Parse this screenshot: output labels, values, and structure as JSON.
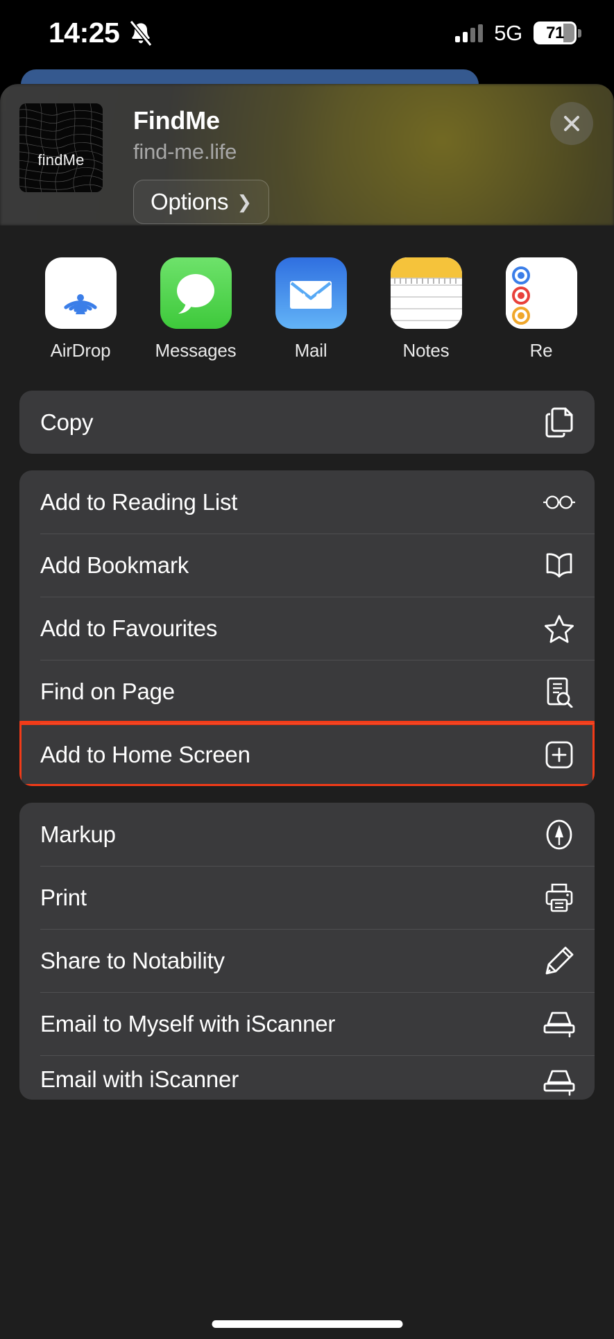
{
  "status_bar": {
    "time": "14:25",
    "silent_icon": "bell-slash-icon",
    "network": "5G",
    "battery_percent": "71",
    "signal_icon": "cellular-signal-icon"
  },
  "share_sheet": {
    "header": {
      "title": "FindMe",
      "subtitle": "find-me.life",
      "thumbnail_label": "findMe",
      "options_label": "Options",
      "options_chevron": "chevron-right-icon",
      "close_icon": "close-icon"
    },
    "apps": [
      {
        "name": "AirDrop",
        "icon": "airdrop-icon"
      },
      {
        "name": "Messages",
        "icon": "messages-icon"
      },
      {
        "name": "Mail",
        "icon": "mail-icon"
      },
      {
        "name": "Notes",
        "icon": "notes-icon"
      },
      {
        "name": "Re",
        "icon": "reminders-icon"
      }
    ],
    "groups": [
      {
        "rows": [
          {
            "label": "Copy",
            "icon": "copy-icon",
            "highlighted": false
          }
        ]
      },
      {
        "rows": [
          {
            "label": "Add to Reading List",
            "icon": "glasses-icon",
            "highlighted": false
          },
          {
            "label": "Add Bookmark",
            "icon": "book-icon",
            "highlighted": false
          },
          {
            "label": "Add to Favourites",
            "icon": "star-icon",
            "highlighted": false
          },
          {
            "label": "Find on Page",
            "icon": "find-page-icon",
            "highlighted": false
          },
          {
            "label": "Add to Home Screen",
            "icon": "plus-square-icon",
            "highlighted": true
          }
        ]
      },
      {
        "rows": [
          {
            "label": "Markup",
            "icon": "markup-icon",
            "highlighted": false
          },
          {
            "label": "Print",
            "icon": "printer-icon",
            "highlighted": false
          },
          {
            "label": "Share to Notability",
            "icon": "pencil-icon",
            "highlighted": false
          },
          {
            "label": "Email to Myself with iScanner",
            "icon": "scanner-icon",
            "highlighted": false
          },
          {
            "label": "Email with iScanner",
            "icon": "scanner-icon",
            "highlighted": false
          }
        ]
      }
    ]
  },
  "colors": {
    "highlight_border": "#f23b18",
    "sheet_background": "#1e1e1e",
    "row_background": "#3a3a3c",
    "tab_blue": "#35598f",
    "messages_green": "#3ec93b",
    "mail_blue": "#2f6fe0",
    "notes_yellow": "#f5c33b",
    "airdrop_blue": "#3b7ee8"
  }
}
